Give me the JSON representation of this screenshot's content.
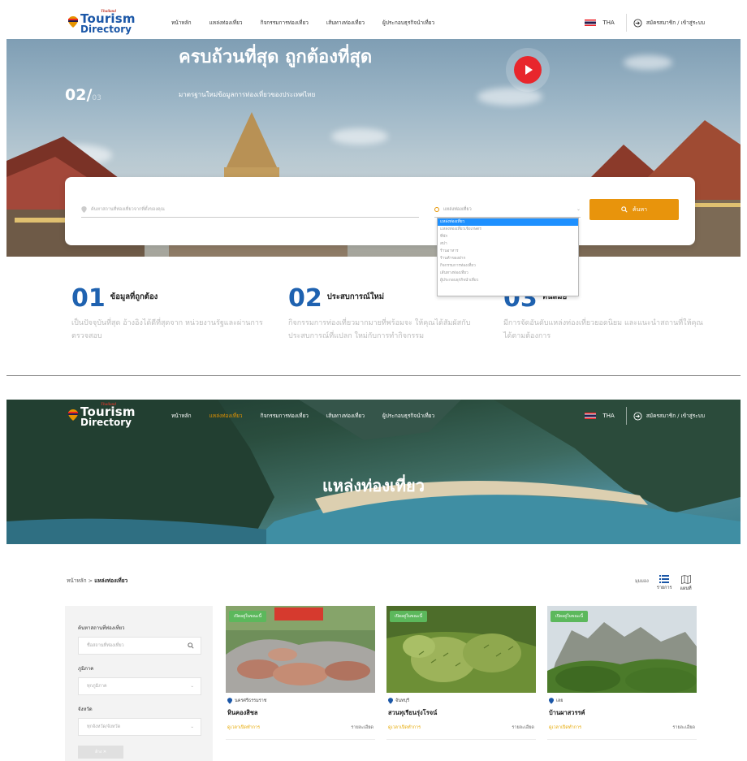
{
  "header": {
    "brand_top": "Thailand",
    "brand_line1": "Tourism",
    "brand_line2": "Directory",
    "nav": [
      "หน้าหลัก",
      "แหล่งท่องเที่ยว",
      "กิจกรรมการท่องเที่ยว",
      "เส้นทางท่องเที่ยว",
      "ผู้ประกอบธุรกิจนำเที่ยว"
    ],
    "language": "THA",
    "login": "สมัครสมาชิก / เข้าสู่ระบบ"
  },
  "hero": {
    "headline": "ครบถ้วนที่สุด ถูกต้องที่สุด",
    "subheadline": "มาตรฐานใหม่ข้อมูลการท่องเที่ยวของประเทศไทย",
    "slide_current": "02/",
    "slide_total": "03"
  },
  "search": {
    "placeholder": "ค้นหาสถานที่ท่องเที่ยวจากที่ตั้งของคุณ",
    "category_value": "แหล่งท่องเที่ยว",
    "button": "ค้นหา",
    "dropdown_options": [
      "แหล่งท่องเที่ยว",
      "แหล่งท่องเที่ยวเชิงเกษตร",
      "ที่พัก",
      "สปา",
      "ร้านอาหาร",
      "ร้านค้าของฝาก",
      "กิจกรรมการท่องเที่ยว",
      "เส้นทางท่องเที่ยว",
      "ผู้ประกอบธุรกิจนำเที่ยว"
    ]
  },
  "features": [
    {
      "num": "01",
      "title": "ข้อมูลที่ถูกต้อง",
      "desc": "เป็นปัจจุบันที่สุด อ้างอิงได้ดีที่สุดจาก หน่วยงานรัฐและผ่านการตรวจสอบ"
    },
    {
      "num": "02",
      "title": "ประสบการณ์ใหม่",
      "desc": "กิจกรรมการท่องเที่ยวมากมายที่พร้อมจะ ให้คุณได้สัมผัสกับประสบการณ์ที่แปลก ใหม่กับการทำกิจกรรม"
    },
    {
      "num": "03",
      "title": "ทันสมัย",
      "desc": "มีการจัดอันดับแหล่งท่องเที่ยวยอดนิยม และแนะนำสถานที่ให้คุณได้ตามต้องการ"
    }
  ],
  "page2": {
    "title": "แหล่งท่องเที่ยว",
    "breadcrumb_home": "หน้าหลัก",
    "breadcrumb_sep": ">",
    "breadcrumb_current": "แหล่งท่องเที่ยว",
    "view_label": "มุมมอง",
    "view_list": "รายการ",
    "view_map": "แผนที่"
  },
  "filters": {
    "search_label": "ค้นหาสถานที่ท่องเที่ยว",
    "search_placeholder": "ชื่อสถานที่ท่องเที่ยว",
    "region_label": "ภูมิภาค",
    "region_value": "ทุกภูมิภาค",
    "province_label": "จังหวัด",
    "province_value": "ทุกจังหวัด/จังหวัด",
    "clear": "ล้าง ✕"
  },
  "cards": [
    {
      "badge": "เปิดอยู่ในขณะนี้",
      "location": "นครศรีธรรมราช",
      "name": "หินคองสิชล",
      "hours": "ดูเวลาเปิดทำการ",
      "more": "รายละเอียด"
    },
    {
      "badge": "เปิดอยู่ในขณะนี้",
      "location": "จันทบุรี",
      "name": "สวนทุเรียนรุ่งโรจน์",
      "hours": "ดูเวลาเปิดทำการ",
      "more": "รายละเอียด"
    },
    {
      "badge": "เปิดอยู่ในขณะนี้",
      "location": "เลย",
      "name": "บ้านผาสวรรค์",
      "hours": "ดูเวลาเปิดทำการ",
      "more": "รายละเอียด"
    }
  ],
  "colors": {
    "accent": "#e8940c",
    "brand": "#1b57a7",
    "badge": "#5cb85c",
    "play": "#e8262c"
  }
}
